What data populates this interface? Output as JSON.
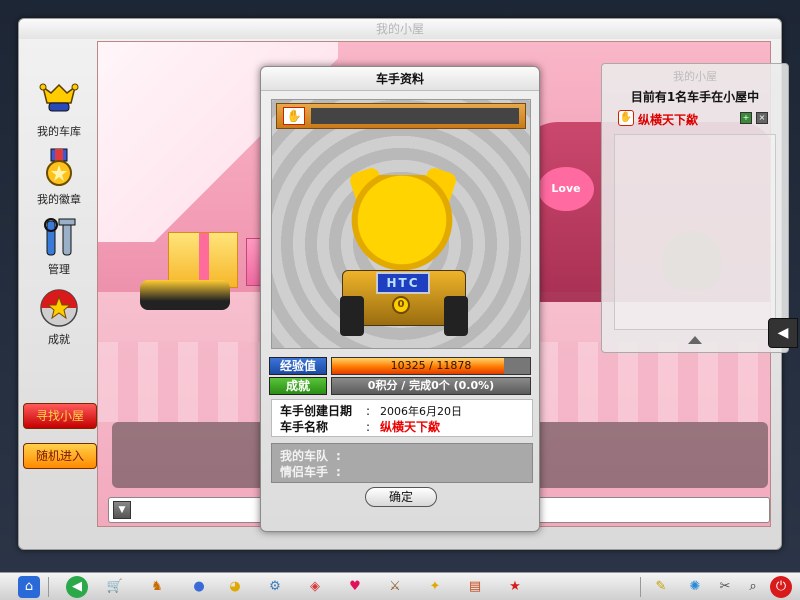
{
  "window": {
    "title": "我的小屋"
  },
  "sidebar": {
    "items": [
      {
        "label": "我的车库",
        "icon": "trophy-wings-icon"
      },
      {
        "label": "我的徽章",
        "icon": "medal-icon"
      },
      {
        "label": "管理",
        "icon": "tools-icon"
      },
      {
        "label": "成就",
        "icon": "star-ball-icon"
      }
    ],
    "find_room_label": "寻找小屋",
    "random_enter_label": "随机进入"
  },
  "room_panel": {
    "ghost_title": "我的小屋",
    "occupancy_text": "目前有1名车手在小屋中",
    "players": [
      {
        "name": "纵横天下歘"
      }
    ],
    "add_friend_icon": "plus-icon",
    "close_icon": "close-icon",
    "scene_sign": "Love"
  },
  "dialog": {
    "title": "车手资料",
    "plate_text": "HTC",
    "plate_badge": "0",
    "experience": {
      "label": "经验值",
      "text": "10325  /  11878",
      "current": 10325,
      "max": 11878
    },
    "achievement": {
      "label": "成就",
      "text": "0积分 / 完成0个  (0.0%)"
    },
    "info": {
      "created_label": "车手创建日期",
      "created_value": "2006年6月20日",
      "name_label": "车手名称",
      "name_value": "纵横天下歘",
      "separator": ":"
    },
    "team": {
      "team_label": "我的车队",
      "partner_label": "情侣车手",
      "separator": ":"
    },
    "ok_label": "确定"
  },
  "taskbar": {
    "icons": [
      "shop-icon",
      "character-icon",
      "potion-icon",
      "pet-icon",
      "settings-gear-icon",
      "kart-parts-icon",
      "heart-icon",
      "sword-icon",
      "wing-icon",
      "book-icon",
      "race-icon",
      "note-icon",
      "network-icon",
      "tools-icon",
      "search-icon",
      "power-icon"
    ]
  },
  "colors": {
    "player_name": "#dd0000",
    "exp_bar": "#ff7a00",
    "exp_label": "#1b4aa3",
    "achievement_label": "#2a8d15",
    "find_room_button": "#c40000",
    "random_button": "#ff8a00"
  }
}
